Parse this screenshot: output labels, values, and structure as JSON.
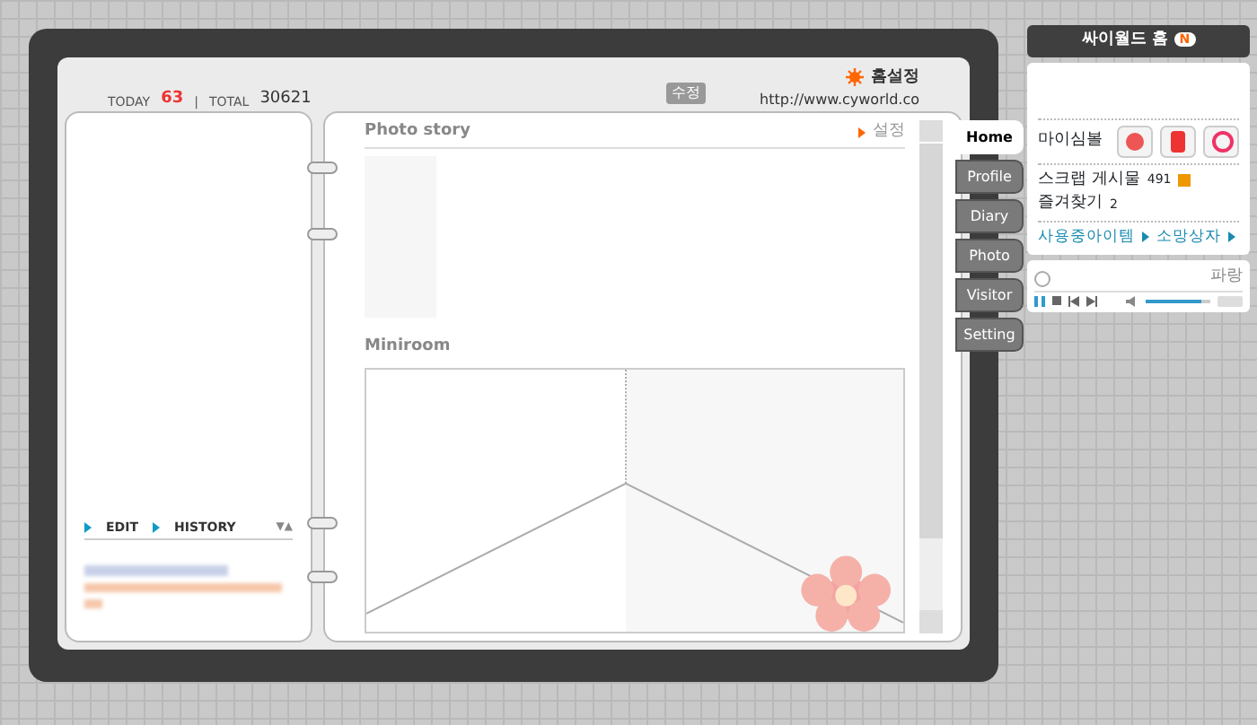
{
  "header": {
    "today_label": "TODAY",
    "today": "63",
    "separator": "|",
    "total_label": "TOTAL",
    "total": "30621",
    "edit_badge": "수정",
    "home_settings": "홈설정",
    "url": "http://www.cyworld.co"
  },
  "left_page": {
    "links": [
      "EDIT",
      "HISTORY"
    ],
    "toggle": "▼▲"
  },
  "main": {
    "photo_title": "Photo story",
    "photo_action": "설정",
    "miniroom_title": "Miniroom"
  },
  "tabs": [
    {
      "label": "Home",
      "selected": true
    },
    {
      "label": "Profile",
      "selected": false
    },
    {
      "label": "Diary",
      "selected": false
    },
    {
      "label": "Photo",
      "selected": false
    },
    {
      "label": "Visitor",
      "selected": false
    },
    {
      "label": "Setting",
      "selected": false
    }
  ],
  "widget": {
    "title": "싸이월드 홈",
    "title_badge": "N",
    "symbol_label": "마이심볼",
    "scrap_label": "스크랩 게시물",
    "scrap_count": "491",
    "fav_label": "즐겨찾기",
    "fav_count": "2",
    "links": [
      "사용중아이템",
      "소망상자"
    ],
    "player": {
      "track": "파랑",
      "volume": {
        "level": 0.85
      }
    }
  }
}
